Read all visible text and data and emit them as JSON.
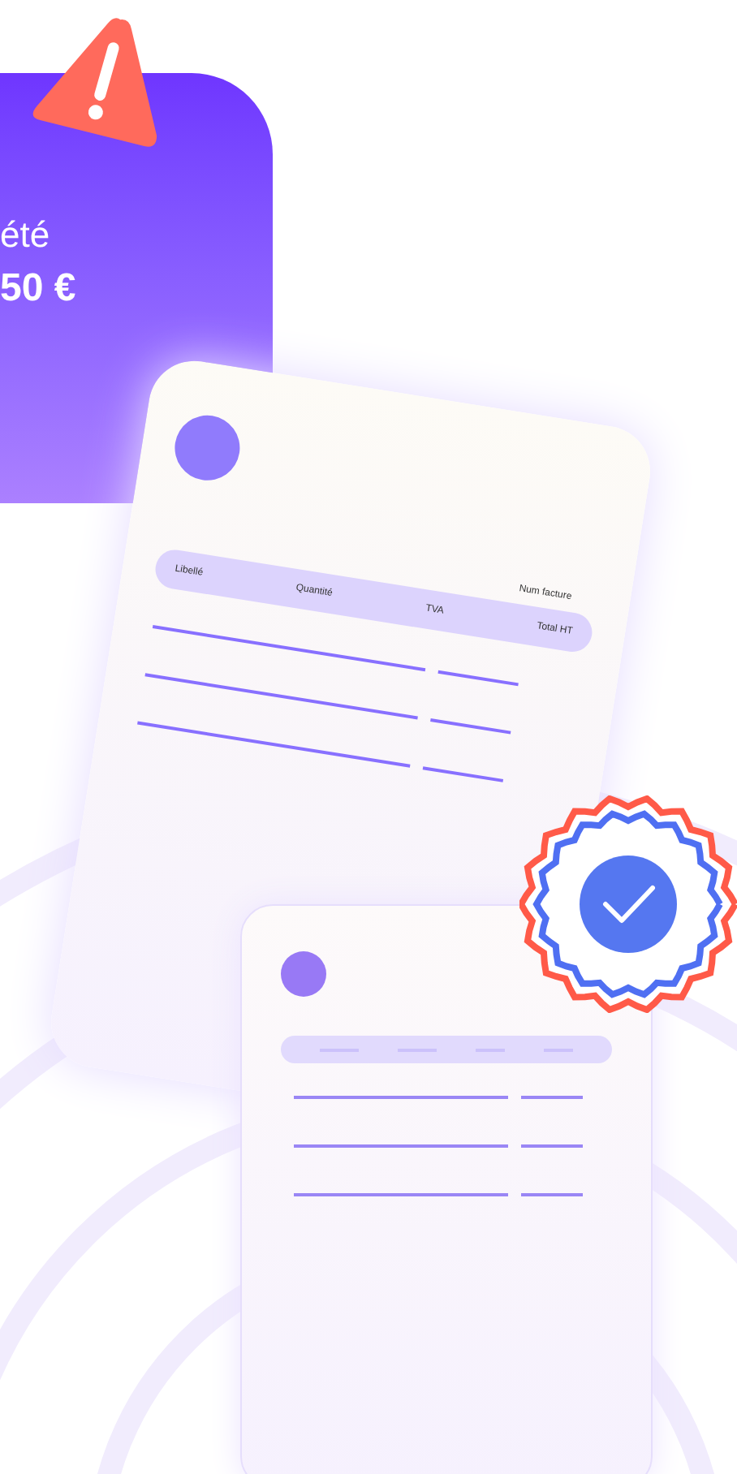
{
  "promo_card": {
    "line_1": "été",
    "amount": "50 €"
  },
  "invoice": {
    "invoice_number_label": "Num facture",
    "columns": [
      "Libellé",
      "Quantité",
      "TVA",
      "Total HT"
    ]
  }
}
